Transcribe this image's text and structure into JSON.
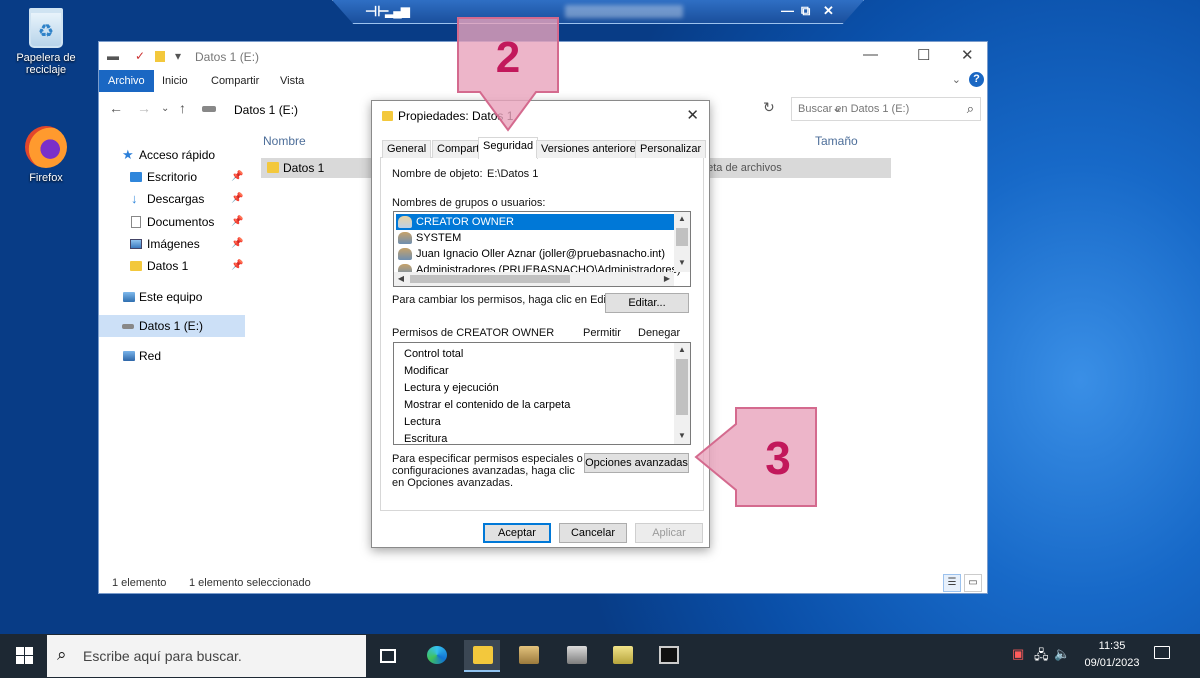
{
  "desktop": {
    "icons": [
      {
        "label": "Papelera de reciclaje",
        "icon": "recycle-bin-icon"
      },
      {
        "label": "Firefox",
        "icon": "firefox-icon"
      }
    ]
  },
  "remote_bar": {
    "pin_icon": "pin-icon",
    "signal_icon": "signal-icon",
    "minimize": "—",
    "restore": "⧉",
    "close": "✕"
  },
  "explorer": {
    "title": "Datos 1 (E:)",
    "ribbon_tabs": [
      "Archivo",
      "Inicio",
      "Compartir",
      "Vista"
    ],
    "help": "?",
    "address": "Datos 1 (E:)",
    "search_placeholder": "Buscar en Datos 1 (E:)",
    "nav": {
      "quick_access": "Acceso rápido",
      "items": [
        "Escritorio",
        "Descargas",
        "Documentos",
        "Imágenes",
        "Datos 1"
      ],
      "this_pc": "Este equipo",
      "drive": "Datos 1 (E:)",
      "network": "Red"
    },
    "columns": {
      "name": "Nombre",
      "size": "Tamaño"
    },
    "file": {
      "name": "Datos 1",
      "type": "peta de archivos"
    },
    "status": {
      "count": "1 elemento",
      "selected": "1 elemento seleccionado"
    }
  },
  "dialog": {
    "title": "Propiedades: Datos 1",
    "tabs": [
      "General",
      "Compartir",
      "Seguridad",
      "Versiones anteriores",
      "Personalizar"
    ],
    "object_label": "Nombre de objeto:",
    "object_value": "E:\\Datos 1",
    "groups_label": "Nombres de grupos o usuarios:",
    "users": [
      "CREATOR OWNER",
      "SYSTEM",
      "Juan Ignacio Oller Aznar (joller@pruebasnacho.int)",
      "Administradores (PRUEBASNACHO\\Administradores)"
    ],
    "change_text": "Para cambiar los permisos, haga clic en Editar.",
    "edit_button": "Editar...",
    "perm_header": "Permisos de CREATOR OWNER",
    "allow": "Permitir",
    "deny": "Denegar",
    "permissions": [
      "Control total",
      "Modificar",
      "Lectura y ejecución",
      "Mostrar el contenido de la carpeta",
      "Lectura",
      "Escritura"
    ],
    "advanced_text": [
      "Para especificar permisos especiales o",
      "configuraciones avanzadas, haga clic",
      "en Opciones avanzadas."
    ],
    "advanced_button": "Opciones avanzadas",
    "ok": "Aceptar",
    "cancel": "Cancelar",
    "apply": "Aplicar"
  },
  "callouts": {
    "step2": "2",
    "step3": "3",
    "color": "#e9a3bb",
    "stroke": "#d46a8e",
    "text_color": "#c2185b"
  },
  "taskbar": {
    "search_placeholder": "Escribe aquí para buscar.",
    "time": "11:35",
    "date": "09/01/2023"
  }
}
